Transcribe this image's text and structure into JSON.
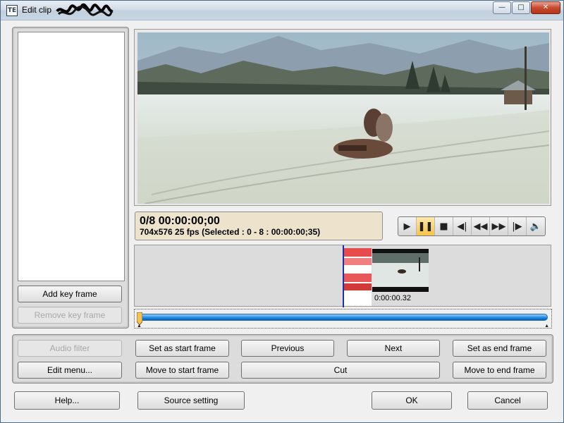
{
  "window": {
    "title": "Edit clip",
    "app_icon_text": "TE",
    "controls": {
      "minimize": "—",
      "maximize": "□",
      "close": "✕"
    }
  },
  "left_panel": {
    "add_key_frame": "Add key frame",
    "remove_key_frame": "Remove key frame"
  },
  "info": {
    "line1": "0/8  00:00:00;00",
    "line2": "704x576 25 fps  (Selected : 0 - 8 : 00:00:00;35)"
  },
  "transport": {
    "play": "▶",
    "pause": "❚❚",
    "stop": "■",
    "prev_frame": "◀|",
    "rewind": "◀◀",
    "fast_forward": "▶▶",
    "next_frame": "|▶",
    "volume": "🔈"
  },
  "timeline": {
    "clip_time": "0:00:00.32"
  },
  "scrubber": {
    "position": 0.0
  },
  "edit_buttons": {
    "audio_filter": "Audio filter",
    "edit_menu": "Edit menu...",
    "set_as_start_frame": "Set as start frame",
    "move_to_start_frame": "Move to start frame",
    "previous": "Previous",
    "next": "Next",
    "cut": "Cut",
    "set_as_end_frame": "Set as end frame",
    "move_to_end_frame": "Move to end frame"
  },
  "footer": {
    "help": "Help...",
    "source_setting": "Source setting",
    "ok": "OK",
    "cancel": "Cancel"
  },
  "colors": {
    "accent_blue": "#1d86e0",
    "info_bg": "#ede3cc",
    "active_transport": "#f5c24a"
  }
}
